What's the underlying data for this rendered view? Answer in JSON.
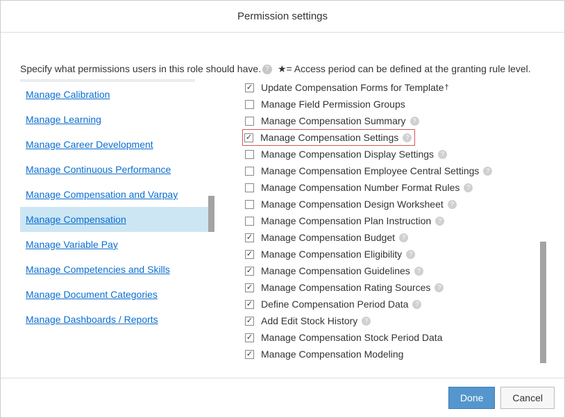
{
  "title": "Permission settings",
  "instruction_prefix": "Specify what permissions users in this role should have.",
  "instruction_suffix": " ★= Access period can be defined at the granting rule level.",
  "sidebar": {
    "items": [
      {
        "label": "Manage Calibration"
      },
      {
        "label": "Manage Learning"
      },
      {
        "label": "Manage Career Development"
      },
      {
        "label": "Manage Continuous Performance"
      },
      {
        "label": "Manage Compensation and Varpay"
      },
      {
        "label": "Manage Compensation"
      },
      {
        "label": "Manage Variable Pay"
      },
      {
        "label": "Manage Competencies and Skills"
      },
      {
        "label": "Manage Document Categories"
      },
      {
        "label": "Manage Dashboards / Reports"
      }
    ],
    "selected_index": 5
  },
  "permissions": [
    {
      "label": "Update Compensation Forms for Template",
      "checked": true,
      "help": false,
      "dagger": true,
      "highlight": false
    },
    {
      "label": "Manage Field Permission Groups",
      "checked": false,
      "help": false,
      "dagger": false,
      "highlight": false
    },
    {
      "label": "Manage Compensation Summary",
      "checked": false,
      "help": true,
      "dagger": false,
      "highlight": false
    },
    {
      "label": "Manage Compensation Settings",
      "checked": true,
      "help": true,
      "dagger": false,
      "highlight": true
    },
    {
      "label": "Manage Compensation Display Settings",
      "checked": false,
      "help": true,
      "dagger": false,
      "highlight": false
    },
    {
      "label": "Manage Compensation Employee Central Settings",
      "checked": false,
      "help": true,
      "dagger": false,
      "highlight": false
    },
    {
      "label": "Manage Compensation Number Format Rules",
      "checked": false,
      "help": true,
      "dagger": false,
      "highlight": false
    },
    {
      "label": "Manage Compensation Design Worksheet",
      "checked": false,
      "help": true,
      "dagger": false,
      "highlight": false
    },
    {
      "label": "Manage Compensation Plan Instruction",
      "checked": false,
      "help": true,
      "dagger": false,
      "highlight": false
    },
    {
      "label": "Manage Compensation Budget",
      "checked": true,
      "help": true,
      "dagger": false,
      "highlight": false
    },
    {
      "label": "Manage Compensation Eligibility",
      "checked": true,
      "help": true,
      "dagger": false,
      "highlight": false
    },
    {
      "label": "Manage Compensation Guidelines",
      "checked": true,
      "help": true,
      "dagger": false,
      "highlight": false
    },
    {
      "label": "Manage Compensation Rating Sources",
      "checked": true,
      "help": true,
      "dagger": false,
      "highlight": false
    },
    {
      "label": "Define Compensation Period Data",
      "checked": true,
      "help": true,
      "dagger": false,
      "highlight": false
    },
    {
      "label": "Add Edit Stock History",
      "checked": true,
      "help": true,
      "dagger": false,
      "highlight": false
    },
    {
      "label": "Manage Compensation Stock Period Data",
      "checked": true,
      "help": false,
      "dagger": false,
      "highlight": false
    },
    {
      "label": "Manage Compensation Modeling",
      "checked": true,
      "help": false,
      "dagger": false,
      "highlight": false
    }
  ],
  "buttons": {
    "done": "Done",
    "cancel": "Cancel"
  }
}
